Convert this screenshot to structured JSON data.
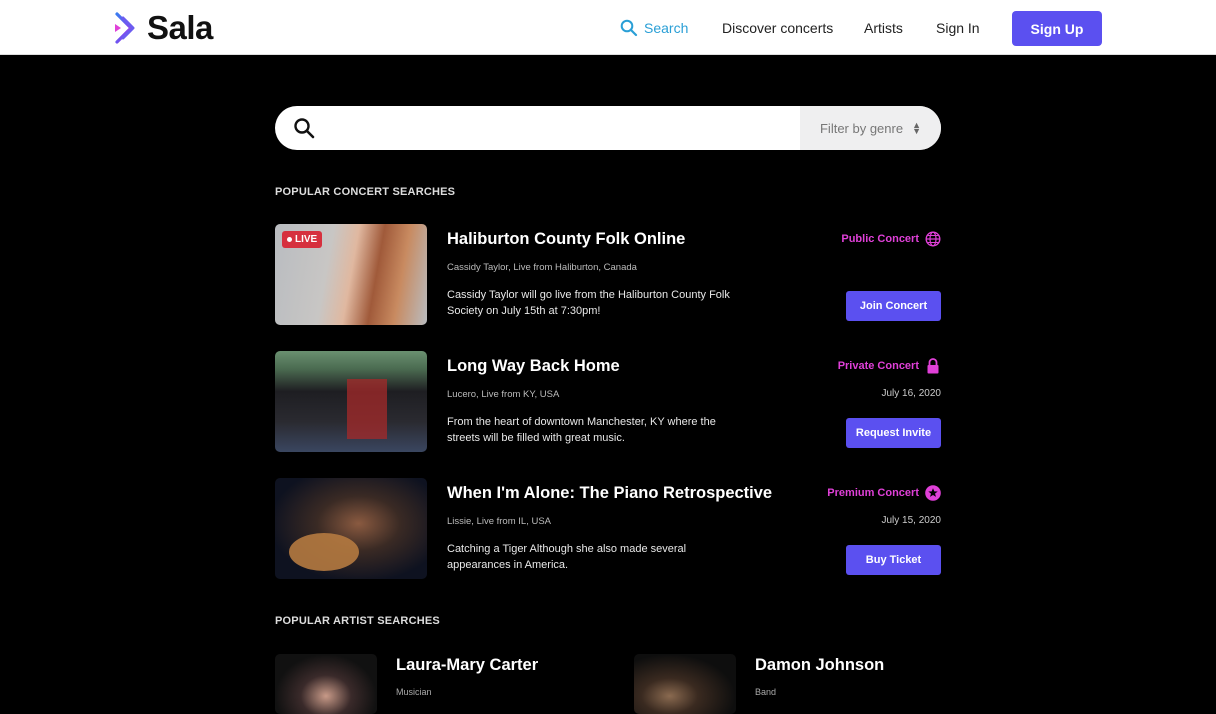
{
  "header": {
    "brand": "Sala",
    "nav": {
      "search": "Search",
      "discover": "Discover concerts",
      "artists": "Artists",
      "sign_in": "Sign In",
      "sign_up": "Sign Up"
    }
  },
  "search": {
    "value": "",
    "placeholder": "",
    "genre_filter": "Filter by genre"
  },
  "popular_concerts": {
    "title": "POPULAR CONCERT SEARCHES",
    "items": [
      {
        "title": "Haliburton County Folk Online",
        "subtitle": "Cassidy Taylor, Live from Haliburton, Canada",
        "description": "Cassidy Taylor will go live from the Haliburton County Folk Society on July 15th at 7:30pm!",
        "type": "Public Concert",
        "type_icon": "globe-icon",
        "date": "",
        "live_badge": "LIVE",
        "action": "Join Concert"
      },
      {
        "title": "Long Way Back Home",
        "subtitle": "Lucero, Live from KY, USA",
        "description": "From the heart of downtown Manchester, KY where the streets will be filled with great music.",
        "type": "Private Concert",
        "type_icon": "lock-icon",
        "date": "July 16, 2020",
        "action": "Request Invite"
      },
      {
        "title": "When I'm Alone: The Piano Retrospective",
        "subtitle": "Lissie, Live from IL, USA",
        "description": "Catching a Tiger Although she also made several appearances in America.",
        "type": "Premium Concert",
        "type_icon": "star-icon",
        "date": "July 15, 2020",
        "action": "Buy Ticket"
      }
    ]
  },
  "popular_artists": {
    "title": "POPULAR ARTIST SEARCHES",
    "items": [
      {
        "name": "Laura-Mary Carter",
        "role": "Musician"
      },
      {
        "name": "Damon Johnson",
        "role": "Band"
      }
    ]
  },
  "colors": {
    "accent": "#5b50f0",
    "concert_type": "#e040d8",
    "search_link": "#2a9fd6",
    "live": "#d6303e"
  }
}
